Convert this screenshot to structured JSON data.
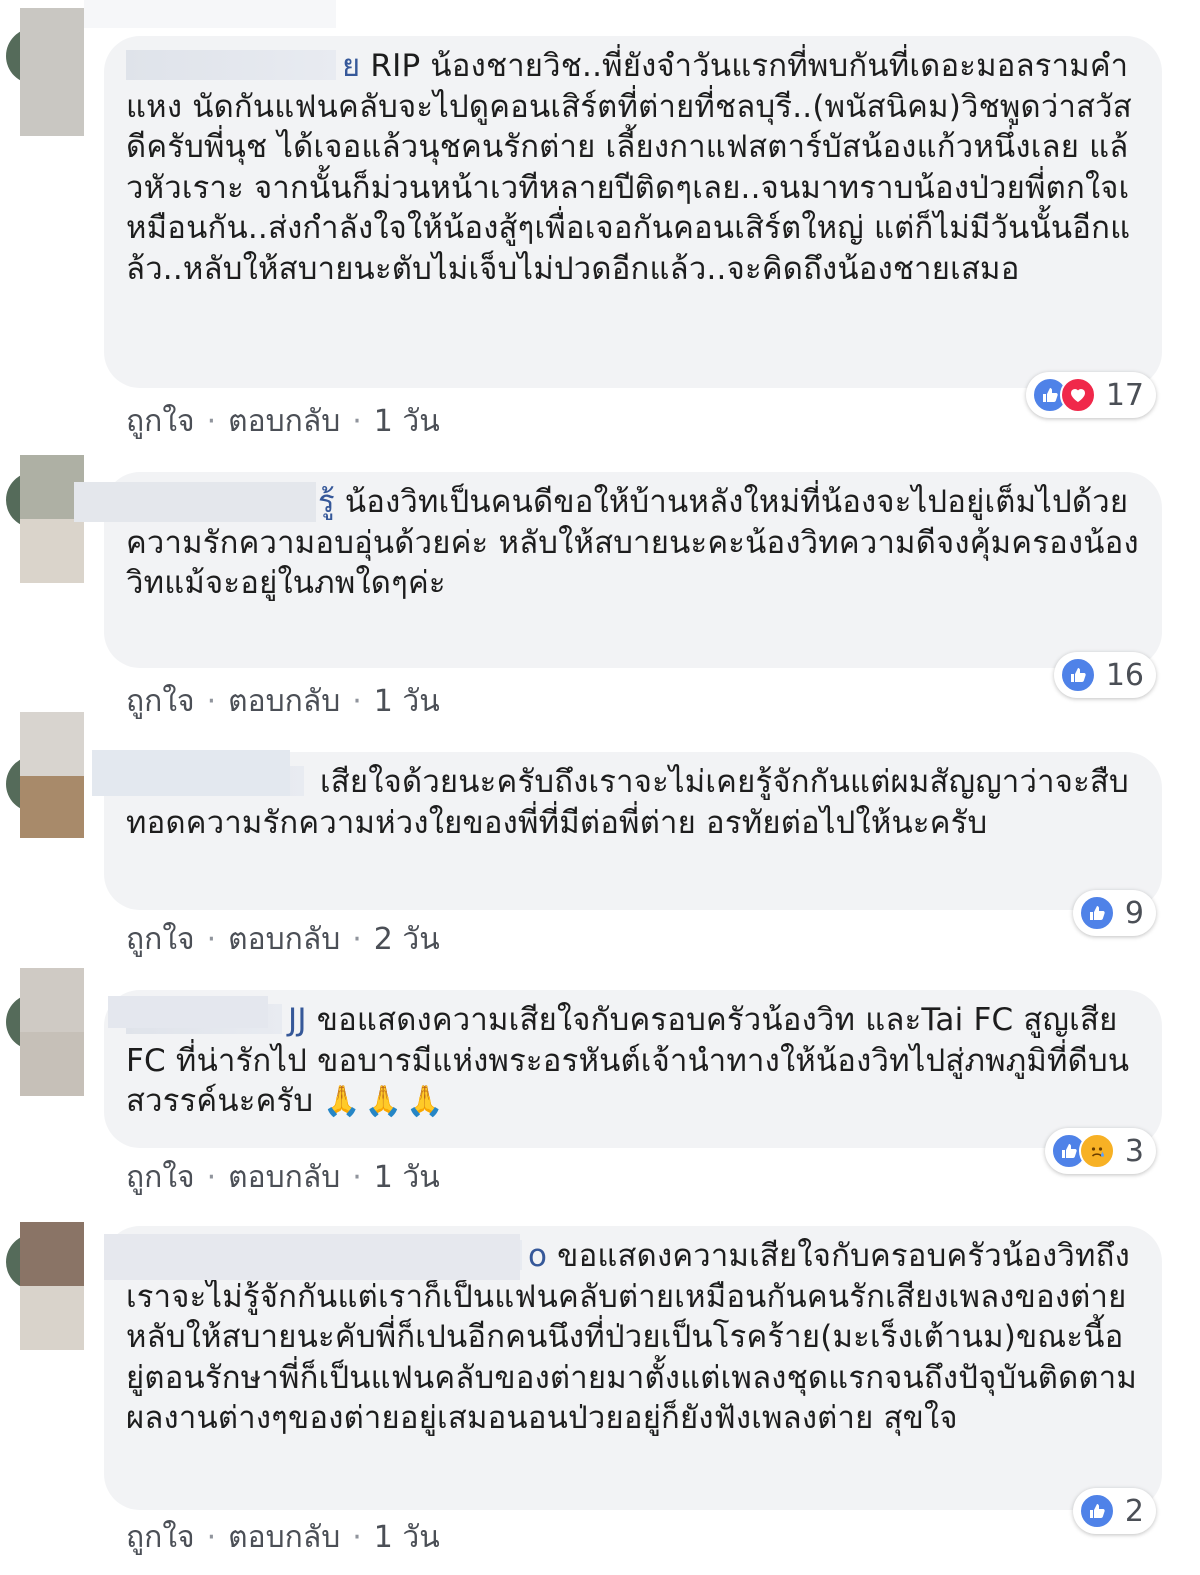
{
  "comments": [
    {
      "name_fragment": "ย",
      "text": "RIP น้องชายวิช..พี่ยังจำวันแรกที่พบกันที่เดอะมอลรามคำแหง นัดกันแฟนคลับจะไปดูคอนเสิร์ตที่ต่ายที่ชลบุรี..(พนัสนิคม)วิชพูดว่าสวัสดีครับพี่นุช ได้เจอแล้วนุชคนรักต่าย เลี้ยงกาแฟสตาร์บัสน้องแก้วหนึ่งเลย แล้วหัวเราะ จากนั้นก็ม่วนหน้าเวทีหลายปีติดๆเลย..จนมาทราบน้องป่วยพี่ตกใจเหมือนกัน..ส่งกำลังใจให้น้องสู้ๆเพื่อเจอกันคอนเสิร์ตใหญ่ แต่ก็ไม่มีวันนั้นอีกแล้ว..หลับให้สบายนะตับไม่เจ็บไม่ปวดอีกแล้ว..จะคิดถึงน้องชายเสมอ",
      "reaction_count": "17",
      "like_label": "ถูกใจ",
      "reply_label": "ตอบกลับ",
      "time": "1 วัน"
    },
    {
      "name_fragment": "รู้",
      "text": "น้องวิทเป็นคนดีขอให้บ้านหลังใหม่ที่น้องจะไปอยู่เต็มไปด้วยความรักความอบอุ่นด้วยค่ะ หลับให้สบายนะคะน้องวิทความดีจงคุ้มครองน้องวิทแม้จะอยู่ในภพใดๆค่ะ",
      "reaction_count": "16",
      "like_label": "ถูกใจ",
      "reply_label": "ตอบกลับ",
      "time": "1 วัน"
    },
    {
      "name_fragment": "",
      "text": "เสียใจด้วยนะครับถึงเราจะไม่เคยรู้จักกันแต่ผมสัญญาว่าจะสืบทอดความรักความห่วงใยของพี่ที่มีต่อพี่ต่าย อรทัยต่อไปให้นะครับ",
      "reaction_count": "9",
      "like_label": "ถูกใจ",
      "reply_label": "ตอบกลับ",
      "time": "2 วัน"
    },
    {
      "name_fragment": "JJ",
      "text": "ขอแสดงความเสียใจกับครอบครัวน้องวิท และTai FC สูญเสีย FC ที่น่ารักไป ขอบารมีแห่งพระอรหันต์เจ้านำทางให้น้องวิทไปสู่ภพภูมิที่ดีบนสวรรค์นะครับ",
      "emoji": "🙏🙏🙏",
      "reaction_count": "3",
      "like_label": "ถูกใจ",
      "reply_label": "ตอบกลับ",
      "time": "1 วัน"
    },
    {
      "name_fragment": "o",
      "text": "ขอแสดงความเสียใจกับครอบครัวน้องวิทถึงเราจะไม่รู้จักกันแต่เราก็เป็นแฟนคลับต่ายเหมือนกันคนรักเสียงเพลงของต่ายหลับให้สบายนะคับพี่ก็เปนอีกคนนึงที่ป่วยเป็นโรคร้าย(มะเร็งเต้านม)ขณะนี้อยู่ตอนรักษาพี่ก็เป็นแฟนคลับของต่ายมาตั้งแต่เพลงชุดแรกจนถึงปัจุบันติดตามผลงานต่างๆของต่ายอยู่เสมอนอนป่วยอยู่ก็ยังฟังเพลงต่าย สุขใจ",
      "reaction_count": "2",
      "like_label": "ถูกใจ",
      "reply_label": "ตอบกลับ",
      "time": "1 วัน"
    }
  ],
  "icons": {
    "like": "like-reaction-icon",
    "love": "love-reaction-icon",
    "sad": "sad-reaction-icon",
    "avatar": "avatar"
  },
  "colors": {
    "bubble": "#f2f3f5",
    "like": "#4f82e8",
    "love": "#f0284a",
    "meta_text": "#4b4f56"
  }
}
